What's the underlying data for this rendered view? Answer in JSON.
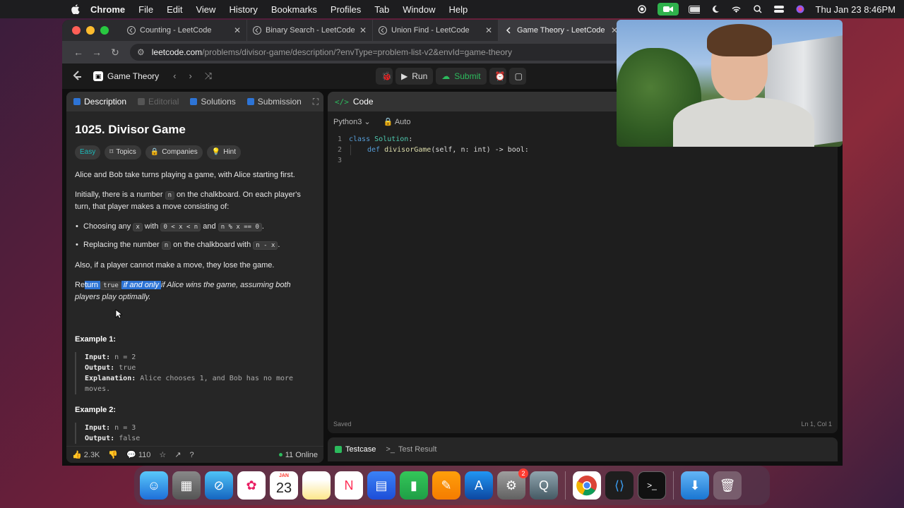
{
  "menubar": {
    "items": [
      "Chrome",
      "File",
      "Edit",
      "View",
      "History",
      "Bookmarks",
      "Profiles",
      "Tab",
      "Window",
      "Help"
    ],
    "datetime": "Thu Jan 23  8:46PM"
  },
  "browser": {
    "tabs": [
      {
        "title": "Counting - LeetCode"
      },
      {
        "title": "Binary Search - LeetCode"
      },
      {
        "title": "Union Find - LeetCode"
      },
      {
        "title": "Game Theory - LeetCode"
      }
    ],
    "url_host": "leetcode.com",
    "url_path": "/problems/divisor-game/description/?envType=problem-list-v2&envId=game-theory"
  },
  "toolbar": {
    "list_name": "Game Theory",
    "run_label": "Run",
    "submit_label": "Submit"
  },
  "left_panel": {
    "tabs": [
      "Description",
      "Editorial",
      "Solutions",
      "Submission"
    ],
    "title": "1025. Divisor Game",
    "tags": [
      "Easy",
      "Topics",
      "Companies",
      "Hint"
    ],
    "para1": "Alice and Bob take turns playing a game, with Alice starting first.",
    "para2_a": "Initially, there is a number ",
    "para2_code": "n",
    "para2_b": " on the chalkboard. On each player's turn, that player makes a move consisting of:",
    "bullet1_a": "Choosing any ",
    "bullet1_code1": "x",
    "bullet1_b": " with ",
    "bullet1_code2": "0 < x < n",
    "bullet1_c": " and ",
    "bullet1_code3": "n % x == 0",
    "bullet1_d": ".",
    "bullet2_a": "Replacing the number ",
    "bullet2_code1": "n",
    "bullet2_b": " on the chalkboard with ",
    "bullet2_code2": "n - x",
    "bullet2_c": ".",
    "para3": "Also, if a player cannot make a move, they lose the game.",
    "para4_a": "Re",
    "para4_hl1": "turn ",
    "para4_code": "true",
    "para4_hl2": " if and only ",
    "para4_b": "if Alice wins the game, assuming both players play optimally.",
    "example1_title": "Example 1:",
    "example1_input_label": "Input:",
    "example1_input": "n = 2",
    "example1_output_label": "Output:",
    "example1_output": "true",
    "example1_expl_label": "Explanation:",
    "example1_expl": "Alice chooses 1, and Bob has no more moves.",
    "example2_title": "Example 2:",
    "example2_input_label": "Input:",
    "example2_input": "n = 3",
    "example2_output_label": "Output:",
    "example2_output": "false",
    "footer_likes": "2.3K",
    "footer_comments": "110",
    "footer_online": "11 Online"
  },
  "code_panel": {
    "header": "Code",
    "language": "Python3",
    "mode": "Auto",
    "line1_kw": "class",
    "line1_cls": "Solution",
    "line1_end": ":",
    "line2_kw": "def",
    "line2_fn": "divisorGame",
    "line2_rest": "(self, n: int) -> bool:",
    "status_saved": "Saved",
    "cursor_pos": "Ln 1, Col 1"
  },
  "test_panel": {
    "testcase_label": "Testcase",
    "result_label": "Test Result"
  },
  "dock": {
    "calendar_month": "JAN",
    "calendar_day": "23",
    "settings_badge": "2"
  },
  "colors": {
    "accent_green": "#2cbb5d",
    "easy_teal": "#1cbaba",
    "selection_blue": "#2d74d6"
  }
}
